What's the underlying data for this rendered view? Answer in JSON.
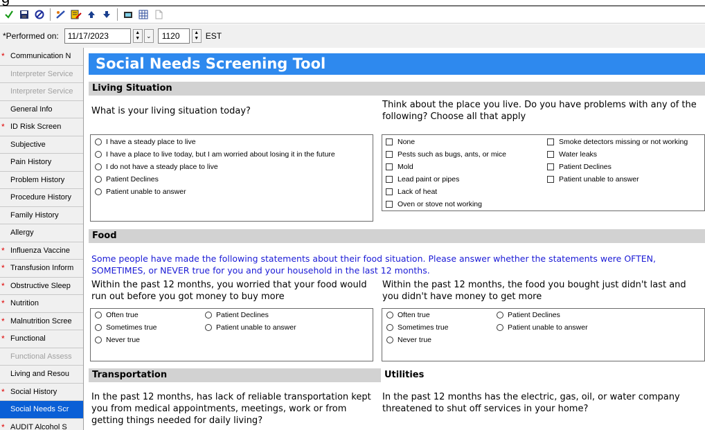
{
  "window": {
    "title_fragment": "g"
  },
  "toolbar": {
    "icons": [
      "checkmark-icon",
      "save-icon",
      "cancel-icon",
      "pencil-icon",
      "form-icon",
      "arrow-up-icon",
      "arrow-down-icon",
      "device-icon",
      "grid-icon",
      "document-icon"
    ]
  },
  "performed": {
    "label": "*Performed on:",
    "date": "11/17/2023",
    "time": "1120",
    "timezone": "EST"
  },
  "sidebar": {
    "items": [
      {
        "label": "Communication N",
        "required": true,
        "state": "normal"
      },
      {
        "label": "Interpreter Service",
        "required": false,
        "state": "disabled"
      },
      {
        "label": "Interpreter Service",
        "required": false,
        "state": "disabled"
      },
      {
        "label": "General Info",
        "required": false,
        "state": "normal"
      },
      {
        "label": "ID Risk Screen",
        "required": true,
        "state": "normal"
      },
      {
        "label": "Subjective",
        "required": false,
        "state": "normal"
      },
      {
        "label": "Pain History",
        "required": false,
        "state": "normal"
      },
      {
        "label": "Problem History",
        "required": false,
        "state": "normal"
      },
      {
        "label": "Procedure History",
        "required": false,
        "state": "normal"
      },
      {
        "label": "Family History",
        "required": false,
        "state": "normal"
      },
      {
        "label": "Allergy",
        "required": false,
        "state": "normal"
      },
      {
        "label": "Influenza Vaccine",
        "required": true,
        "state": "normal"
      },
      {
        "label": "Transfusion Inform",
        "required": true,
        "state": "normal"
      },
      {
        "label": "Obstructive Sleep",
        "required": true,
        "state": "normal"
      },
      {
        "label": "Nutrition",
        "required": true,
        "state": "normal"
      },
      {
        "label": "Malnutrition Scree",
        "required": true,
        "state": "normal"
      },
      {
        "label": "Functional",
        "required": true,
        "state": "normal"
      },
      {
        "label": "Functional Assess",
        "required": false,
        "state": "disabled"
      },
      {
        "label": "Living and Resou",
        "required": false,
        "state": "normal"
      },
      {
        "label": "Social History",
        "required": true,
        "state": "normal"
      },
      {
        "label": "Social Needs Scr",
        "required": false,
        "state": "active"
      },
      {
        "label": "AUDIT Alcohol S",
        "required": true,
        "state": "normal"
      }
    ]
  },
  "form": {
    "title": "Social Needs Screening Tool",
    "living": {
      "header": "Living Situation",
      "q1": "What is your living situation today?",
      "q1_options": [
        "I have a steady place to live",
        "I have a place to live today, but I am worried about losing it in the future",
        "I do not have a steady place to live",
        "Patient Declines",
        "Patient unable to answer"
      ],
      "q2": "Think about the place you live. Do you have problems with any of the following? Choose all that apply",
      "q2_col1": [
        "None",
        "Pests such as bugs, ants, or mice",
        "Mold",
        "Lead paint or pipes",
        "Lack of heat",
        "Oven or stove not working"
      ],
      "q2_col2": [
        "Smoke detectors missing or not working",
        "Water leaks",
        "Patient Declines",
        "Patient unable to answer"
      ]
    },
    "food": {
      "header": "Food",
      "intro": "Some people have made the following statements about their food situation. Please answer whether the statements were OFTEN, SOMETIMES, or NEVER true for you and your household in the last 12 months.",
      "q1": "Within the past 12 months, you worried that your food would run out before you got money to buy more",
      "q2": "Within the past 12 months, the food you bought just didn't last and you didn't have money to get more",
      "options_col1": [
        "Often true",
        "Sometimes true",
        "Never true"
      ],
      "options_col2": [
        "Patient Declines",
        "Patient unable to answer"
      ]
    },
    "transportation": {
      "header": "Transportation",
      "q": "In the past 12 months, has lack of reliable transportation kept you from medical appointments, meetings, work or from getting things needed for daily living?"
    },
    "utilities": {
      "header": "Utilities",
      "q": "In the past 12 months has the electric, gas, oil, or water company threatened to shut off services in your home?"
    }
  }
}
